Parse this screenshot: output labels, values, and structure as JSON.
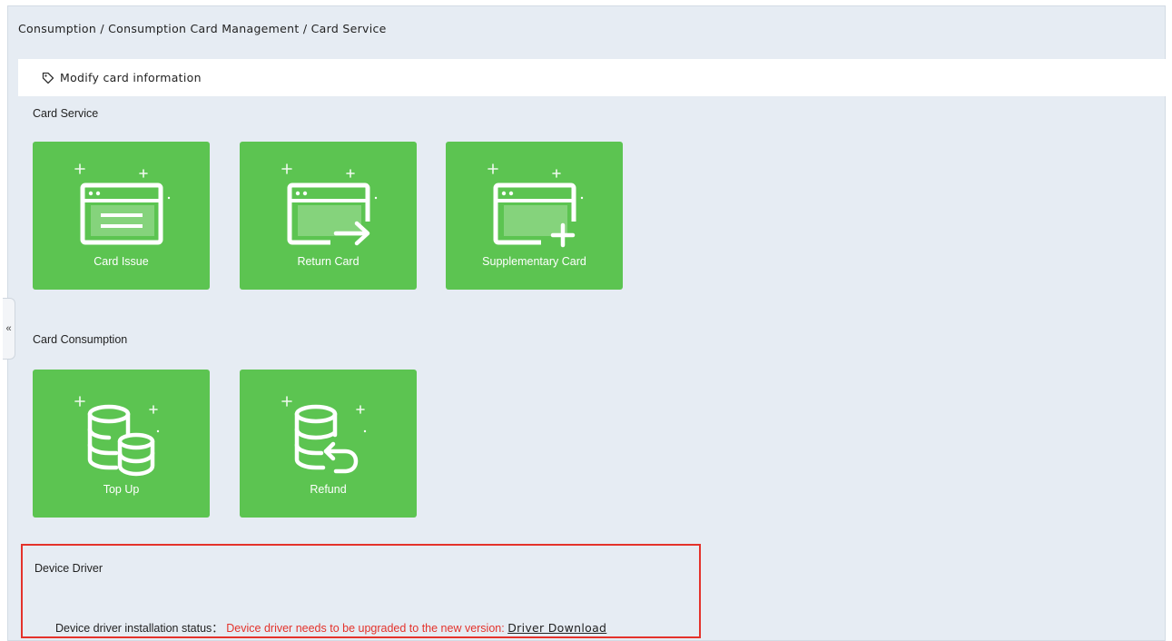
{
  "breadcrumb": "Consumption / Consumption Card Management / Card Service",
  "subbar": {
    "label": "Modify card information",
    "icon": "tag-icon"
  },
  "collapse_tab": {
    "glyph": "«"
  },
  "card_service": {
    "title": "Card Service",
    "tiles": [
      {
        "label": "Card Issue",
        "icon": "card-issue-icon"
      },
      {
        "label": "Return Card",
        "icon": "return-card-icon"
      },
      {
        "label": "Supplementary Card",
        "icon": "supplementary-card-icon"
      }
    ]
  },
  "card_consumption": {
    "title": "Card Consumption",
    "tiles": [
      {
        "label": "Top Up",
        "icon": "top-up-icon"
      },
      {
        "label": "Refund",
        "icon": "refund-icon"
      }
    ]
  },
  "device_driver": {
    "title": "Device Driver",
    "status_label": "Device driver installation status：",
    "status_message": "Device driver needs to be upgraded to the new version:",
    "download_link": "Driver Download"
  },
  "colors": {
    "tile_green": "#5cc451",
    "background": "#e6ecf3",
    "alert_red": "#e4322b"
  }
}
